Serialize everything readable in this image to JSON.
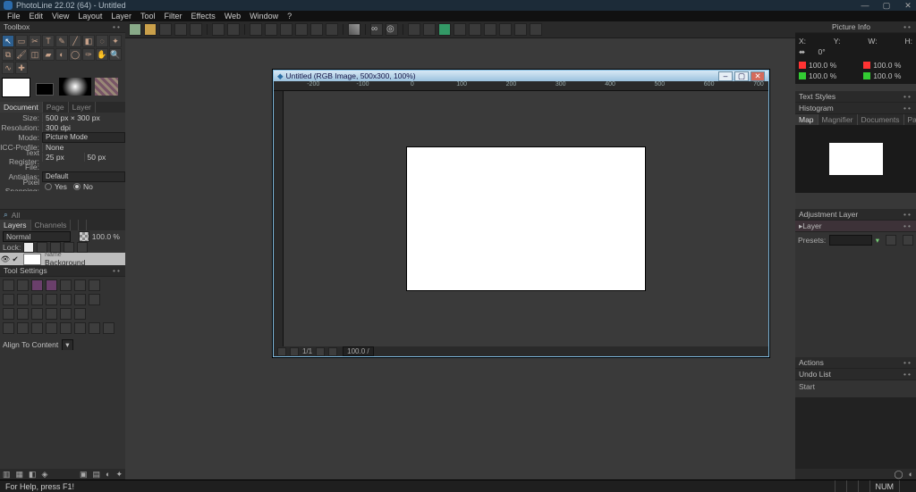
{
  "titlebar": {
    "text": "PhotoLine 22.02 (64) - Untitled"
  },
  "menu": [
    "File",
    "Edit",
    "View",
    "Layout",
    "Layer",
    "Tool",
    "Filter",
    "Effects",
    "Web",
    "Window",
    "?"
  ],
  "toolbox": {
    "header": "Toolbox",
    "tools": [
      "arrow",
      "rect-select",
      "crop",
      "text",
      "paint",
      "measure",
      "eyedrop",
      "lasso",
      "wand",
      "clone",
      "brush",
      "eraser",
      "fill",
      "gradient",
      "shape",
      "pen",
      "hand",
      "zoom",
      "smudge",
      "heal"
    ]
  },
  "doc_tabs": [
    "Document",
    "Page",
    "Layer"
  ],
  "doc_props": {
    "size_label": "Size:",
    "size_value": "500 px × 300 px",
    "res_label": "Resolution:",
    "res_value": "300 dpi",
    "mode_label": "Mode:",
    "mode_value": "Picture Mode",
    "icc_label": "ICC-Profile:",
    "icc_value": "None",
    "reg_label": "Text Register:",
    "reg_v1": "25 px",
    "reg_v2": "50 px",
    "file_label": "File:",
    "file_value": "",
    "aa_label": "Antialias:",
    "aa_value": "Default",
    "snap_label": "Pixel Snapping:",
    "snap_yes": "Yes",
    "snap_no": "No"
  },
  "cmd_placeholder": "All",
  "layers": {
    "tabs": [
      "Layers",
      "Channels"
    ],
    "blend": "Normal",
    "opacity": "100.0 %",
    "lock": "Lock:",
    "layer_name": "Name",
    "layer_value": "Background"
  },
  "toolsettings": {
    "header": "Tool Settings",
    "align": "Align To Content"
  },
  "canvas": {
    "title": "Untitled (RGB Image, 500x300, 100%)",
    "page_num": "1/1",
    "zoom": "100.0 /"
  },
  "picture_info": {
    "header": "Picture Info",
    "x": "X:",
    "y": "Y:",
    "w": "W:",
    "h": "H:",
    "angle": "0°",
    "c1": "100.0 %",
    "c2": "100.0 %",
    "c3": "100.0 %",
    "c4": "100.0 %"
  },
  "right_tabs1": [
    "Text Styles"
  ],
  "right_tabs2": [
    "Histogram"
  ],
  "right_tabs3": [
    "Map",
    "Magnifier",
    "Documents",
    "Pages"
  ],
  "adjustment": {
    "header": "Adjustment Layer",
    "sub": "Layer",
    "preset": "Presets:"
  },
  "actions": {
    "header": "Actions"
  },
  "undo": {
    "header": "Undo List",
    "item": "Start"
  },
  "statusbar": {
    "help": "For Help, press F1!",
    "num": "NUM"
  }
}
